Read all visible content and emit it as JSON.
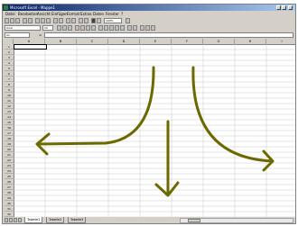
{
  "window": {
    "title": "Microsoft Excel - Mappe1"
  },
  "menu": [
    "Datei",
    "Bearbeiten",
    "Ansicht",
    "Einfügen",
    "Format",
    "Extras",
    "Daten",
    "Fenster",
    "?"
  ],
  "toolbar": {
    "zoom": "100%",
    "font": "Arial",
    "font_size": "10"
  },
  "formula_bar": {
    "name_box": "A1",
    "equals": "=",
    "content": ""
  },
  "columns": [
    "A",
    "B",
    "C",
    "D",
    "E",
    "F",
    "G",
    "H",
    "I"
  ],
  "rows": [
    "1",
    "2",
    "3",
    "4",
    "5",
    "6",
    "7",
    "8",
    "9",
    "10",
    "11",
    "12",
    "13",
    "14",
    "15",
    "16",
    "17",
    "18",
    "19",
    "20",
    "21",
    "22",
    "23",
    "24",
    "25",
    "26",
    "27",
    "28",
    "29",
    "30",
    "31",
    "32"
  ],
  "sheet_tabs": [
    "Tabelle1",
    "Tabelle2",
    "Tabelle3"
  ],
  "active_sheet": "Tabelle1",
  "drawing": {
    "stroke_color": "#6b6a00",
    "arrows": [
      "left-arrow",
      "down-arrow",
      "right-arrow"
    ]
  }
}
